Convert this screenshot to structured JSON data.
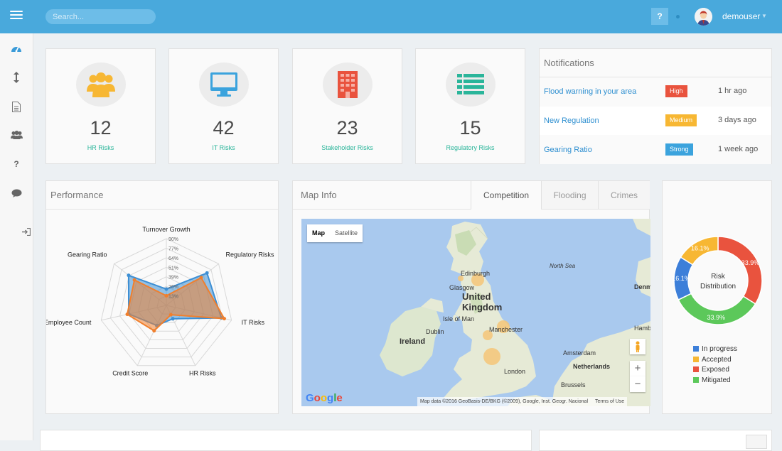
{
  "topbar": {
    "search_placeholder": "Search...",
    "help_label": "?",
    "username": "demouser"
  },
  "sidebar": {
    "icons": [
      "dashboard-icon",
      "sort-icon",
      "document-icon",
      "users-icon",
      "question-icon",
      "chat-icon",
      "sign-in-icon"
    ]
  },
  "stats": [
    {
      "value": "12",
      "label": "HR Risks",
      "icon": "users-icon",
      "color": "#f7b733"
    },
    {
      "value": "42",
      "label": "IT Risks",
      "icon": "desktop-icon",
      "color": "#3ba3dd"
    },
    {
      "value": "23",
      "label": "Stakeholder Risks",
      "icon": "building-icon",
      "color": "#e9533e"
    },
    {
      "value": "15",
      "label": "Regulatory Risks",
      "icon": "list-icon",
      "color": "#2ab59a"
    }
  ],
  "notifications": {
    "title": "Notifications",
    "rows": [
      {
        "text": "Flood warning in your area",
        "badge": "High",
        "badge_color": "#e9533e",
        "time": "1 hr ago"
      },
      {
        "text": "New Regulation",
        "badge": "Medium",
        "badge_color": "#f7b733",
        "time": "3 days ago"
      },
      {
        "text": "Gearing Ratio",
        "badge": "Strong",
        "badge_color": "#3ba3dd",
        "time": "1 week ago"
      }
    ]
  },
  "performance": {
    "title": "Performance"
  },
  "chart_data": [
    {
      "type": "radar",
      "axes": [
        "Turnover Growth",
        "Regulatory Risks",
        "IT Risks",
        "HR Risks",
        "Credit Score",
        "Employee Count",
        "Gearing Ratio"
      ],
      "tick_labels": [
        "13%",
        "26%",
        "39%",
        "51%",
        "64%",
        "77%",
        "90%"
      ],
      "range": [
        0,
        90
      ],
      "series": [
        {
          "color": "#3d8fd4",
          "values": [
            22,
            70,
            76,
            20,
            30,
            52,
            65
          ]
        },
        {
          "color": "#f07f2d",
          "values": [
            13,
            60,
            80,
            14,
            38,
            54,
            55
          ]
        }
      ]
    },
    {
      "type": "pie",
      "title": "Risk Distribution",
      "slices": [
        {
          "name": "Exposed",
          "value": 33.9,
          "color": "#e9533e",
          "label": "33.9%"
        },
        {
          "name": "Mitigated",
          "value": 33.9,
          "color": "#5cc85a",
          "label": "33.9%"
        },
        {
          "name": "In progress",
          "value": 16.1,
          "color": "#3d7fd9",
          "label": "16.1%"
        },
        {
          "name": "Accepted",
          "value": 16.1,
          "color": "#f7b733",
          "label": "16.1%"
        }
      ],
      "legend": [
        "In progress",
        "Accepted",
        "Exposed",
        "Mitigated"
      ]
    }
  ],
  "mapinfo": {
    "title": "Map Info",
    "tabs": [
      "Competition",
      "Flooding",
      "Crimes"
    ],
    "map_type": [
      "Map",
      "Satellite"
    ],
    "labels": {
      "edinburgh": "Edinburgh",
      "glasgow": "Glasgow",
      "uk": "United Kingdom",
      "isle_of_man": "Isle of Man",
      "dublin": "Dublin",
      "ireland": "Ireland",
      "manchester": "Manchester",
      "north_sea": "North Sea",
      "amsterdam": "Amsterdam",
      "netherlands": "Netherlands",
      "london": "London",
      "brussels": "Brussels",
      "denmark": "Denm",
      "hamburg": "Hamb"
    },
    "google": "Google",
    "attribution": "Map data ©2016 GeoBasis-DE/BKG (©2009), Google, Inst. Geogr. Nacional",
    "terms": "Terms of Use",
    "zoom_in": "+",
    "zoom_out": "−"
  }
}
